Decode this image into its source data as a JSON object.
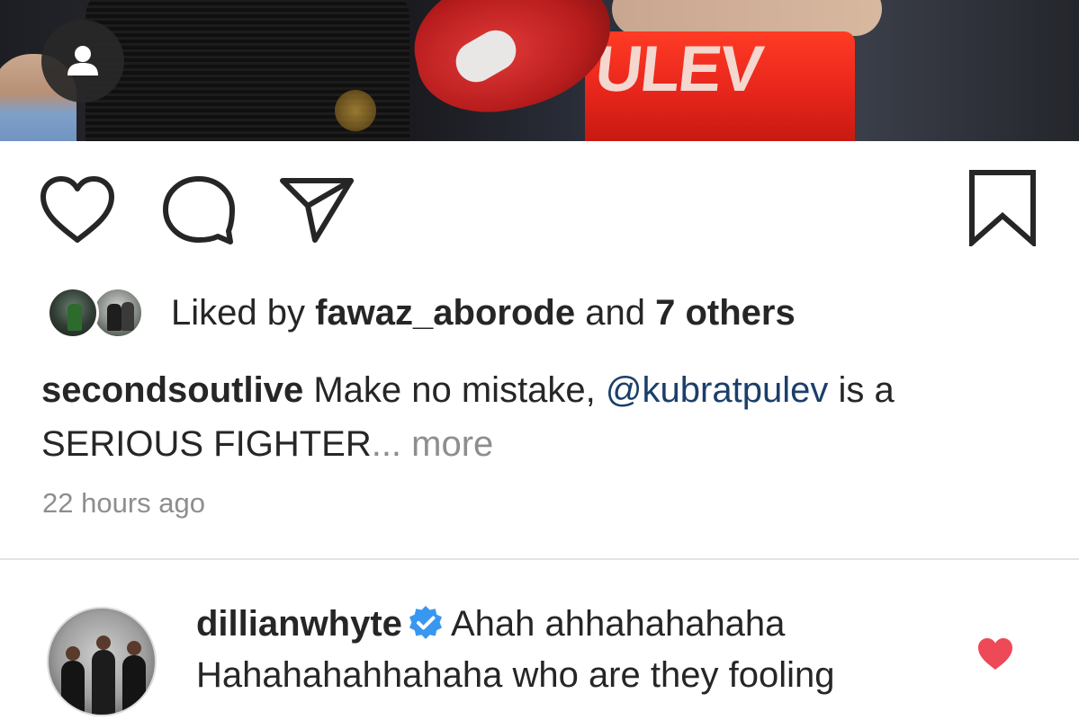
{
  "photo": {
    "trunks_text": "ULEV"
  },
  "actions": {
    "like_icon": "heart-outline-icon",
    "comment_icon": "comment-bubble-icon",
    "share_icon": "paper-plane-icon",
    "save_icon": "bookmark-outline-icon"
  },
  "likes": {
    "prefix": "Liked by",
    "user": "fawaz_aborode",
    "joiner": "and",
    "others": "7 others"
  },
  "caption": {
    "username": "secondsoutlive",
    "text_before": "Make no mistake,",
    "mention": "@kubratpulev",
    "text_after": "is a SERIOUS FIGHTER",
    "ellipsis": "...",
    "more": "more"
  },
  "timestamp": "22 hours ago",
  "comment": {
    "username": "dillianwhyte",
    "verified": true,
    "text": "Ahah ahhahahahaha Hahahahahhahaha who are they fooling",
    "liked": true
  },
  "colors": {
    "text": "#262626",
    "secondary": "#8e8e8e",
    "mention": "#1b3f6a",
    "verified": "#3897f0",
    "heart": "#ed4956"
  }
}
